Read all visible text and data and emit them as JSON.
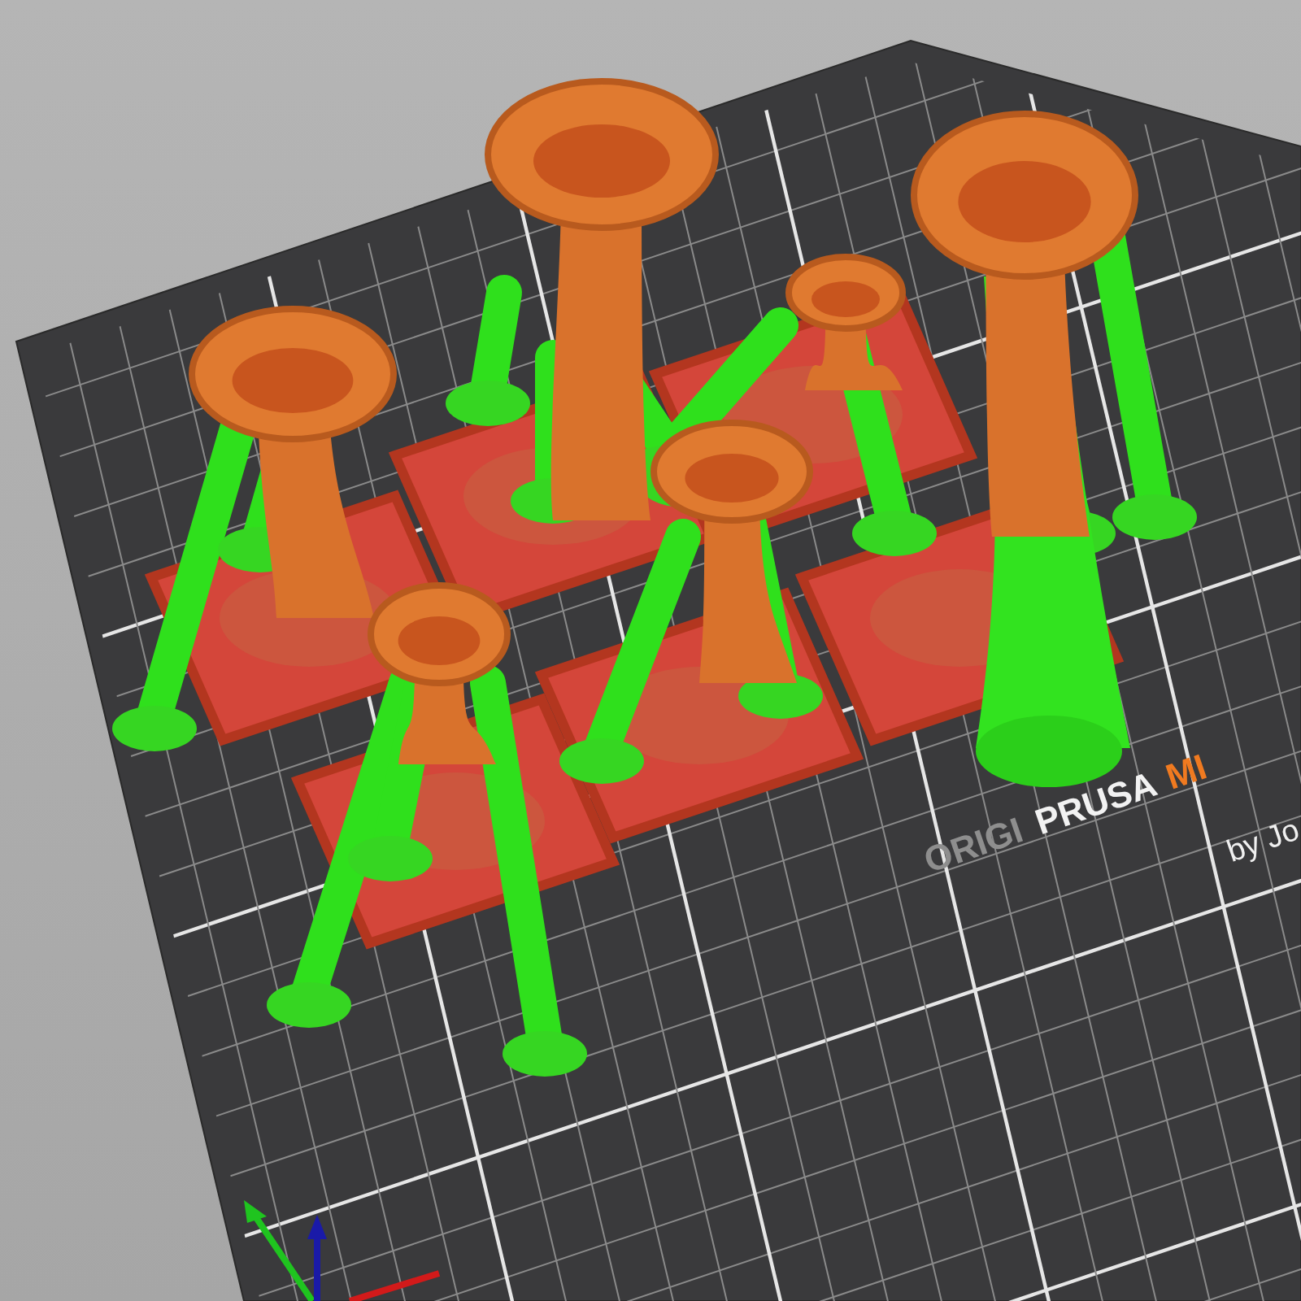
{
  "viewport": {
    "bed_logo": [
      {
        "text": "ORIGI",
        "kind": "plain"
      },
      {
        "text": "PRUSA",
        "kind": "strong"
      },
      {
        "text": "MI",
        "kind": "accent"
      }
    ],
    "bed_caption": "by Jo"
  }
}
